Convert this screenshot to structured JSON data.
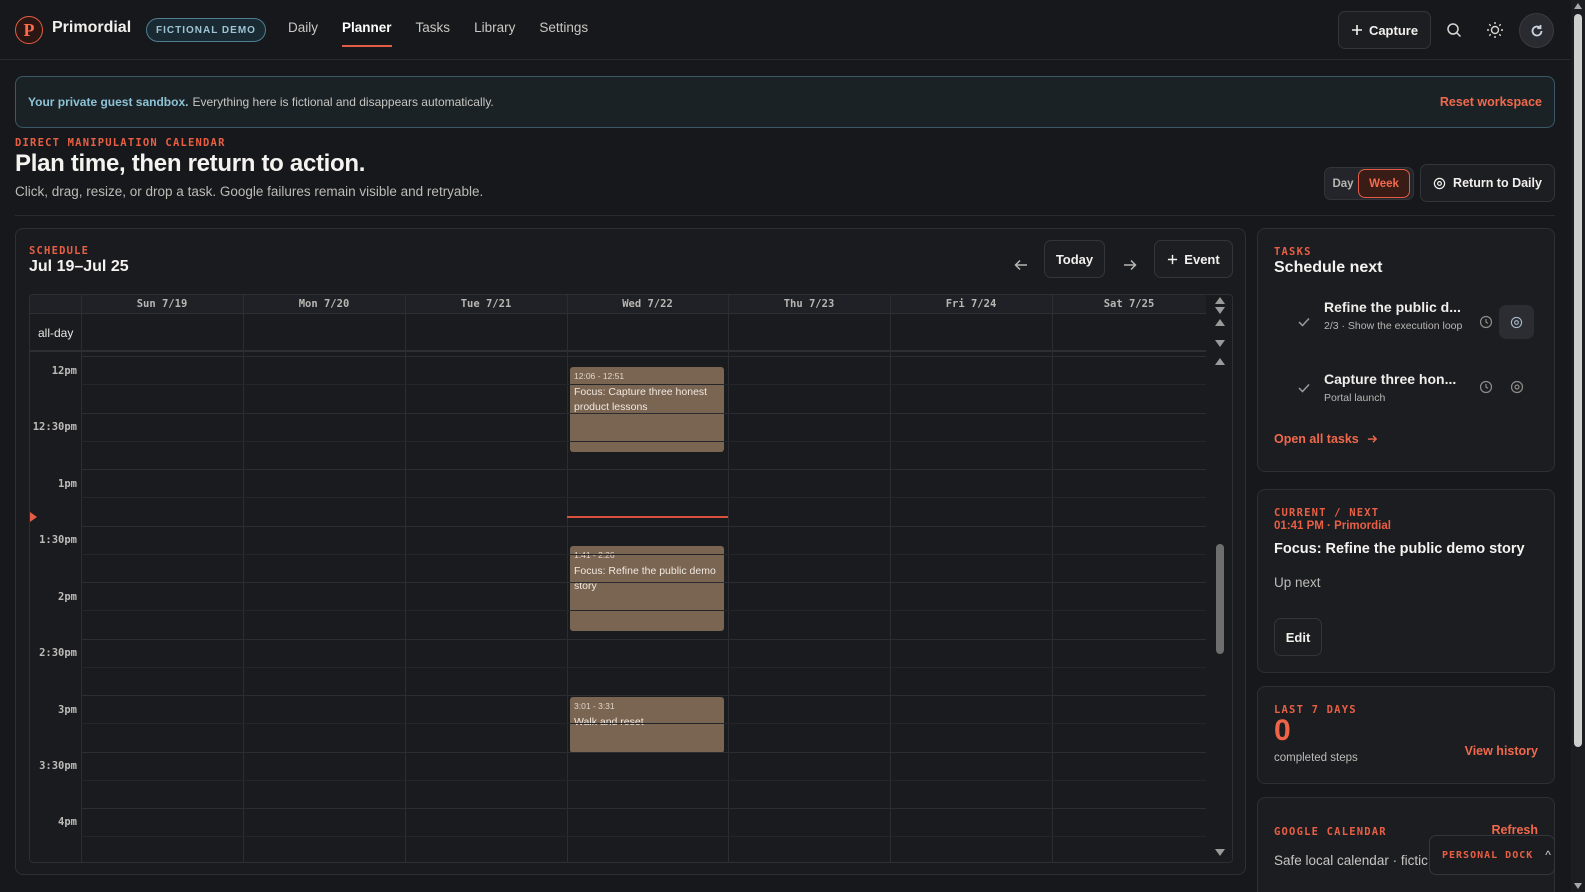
{
  "app": {
    "logo_letter": "P",
    "brand": "Primordial",
    "badge": "FICTIONAL DEMO"
  },
  "nav": {
    "items": [
      {
        "label": "Daily",
        "active": false
      },
      {
        "label": "Planner",
        "active": true
      },
      {
        "label": "Tasks",
        "active": false
      },
      {
        "label": "Library",
        "active": false
      },
      {
        "label": "Settings",
        "active": false
      }
    ]
  },
  "toolbar": {
    "capture_label": "Capture",
    "search_icon": "search-icon",
    "theme_icon": "sun-icon",
    "avatar_icon": "refresh-icon"
  },
  "banner": {
    "strong": "Your private guest sandbox.",
    "text": "Everything here is fictional and disappears automatically.",
    "reset_label": "Reset workspace"
  },
  "header": {
    "eyebrow": "DIRECT MANIPULATION CALENDAR",
    "title": "Plan time, then return to action.",
    "subtitle": "Click, drag, resize, or drop a task. Google failures remain visible and retryable.",
    "view_day": "Day",
    "view_week": "Week",
    "return_label": "Return to Daily"
  },
  "schedule": {
    "eyebrow": "SCHEDULE",
    "range": "Jul 19–Jul 25",
    "today_label": "Today",
    "event_label": "Event",
    "allday_label": "all-day",
    "days": [
      "Sun 7/19",
      "Mon 7/20",
      "Tue 7/21",
      "Wed 7/22",
      "Thu 7/23",
      "Fri 7/24",
      "Sat 7/25"
    ],
    "times": [
      "12pm",
      "12:30pm",
      "1pm",
      "1:30pm",
      "2pm",
      "2:30pm",
      "3pm",
      "3:30pm",
      "4pm"
    ],
    "events": [
      {
        "day": 3,
        "start_min": 726,
        "end_min": 771,
        "time": "12:06 - 12:51",
        "title": "Focus: Capture three honest product lessons"
      },
      {
        "day": 3,
        "start_min": 821,
        "end_min": 866,
        "time": "1:41 - 2:26",
        "title": "Focus: Refine the public demo story"
      },
      {
        "day": 3,
        "start_min": 901,
        "end_min": 931,
        "time": "3:01 - 3:31",
        "title": "Walk and reset"
      }
    ],
    "now_min": 805,
    "now_day": 3,
    "colors": {
      "event": "#7a6452",
      "accent": "#e25d43"
    }
  },
  "tasks_card": {
    "eyebrow": "TASKS",
    "title": "Schedule next",
    "tasks": [
      {
        "name": "Refine the public d...",
        "meta": "2/3 · Show the execution loop"
      },
      {
        "name": "Capture three hon...",
        "meta": "Portal launch"
      }
    ],
    "open_all": "Open all tasks"
  },
  "current_card": {
    "eyebrow": "CURRENT / NEXT",
    "time": "01:41 PM · Primordial",
    "title": "Focus: Refine the public demo story",
    "up_next": "Up next",
    "edit_label": "Edit"
  },
  "history_card": {
    "eyebrow": "LAST 7 DAYS",
    "count": "0",
    "caption": "completed steps",
    "link": "View history"
  },
  "google_card": {
    "eyebrow": "GOOGLE CALENDAR",
    "refresh": "Refresh",
    "text": "Safe local calendar · fictic"
  },
  "dock": {
    "label": "PERSONAL DOCK",
    "chevron": "^"
  }
}
